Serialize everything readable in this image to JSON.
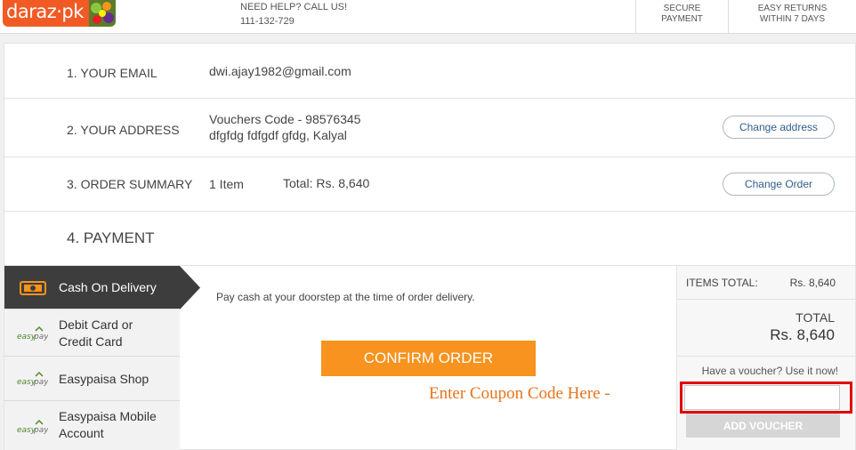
{
  "header": {
    "logo_text": "daraz·pk",
    "help_title": "NEED HELP? CALL US!",
    "help_phone": "111-132-729",
    "secure_line1": "SECURE",
    "secure_line2": "PAYMENT",
    "returns_line1": "EASY RETURNS",
    "returns_line2": "WITHIN 7 DAYS"
  },
  "steps": {
    "email": {
      "label": "1. YOUR EMAIL",
      "value": "dwi.ajay1982@gmail.com"
    },
    "address": {
      "label": "2. YOUR ADDRESS",
      "line1": "Vouchers Code - 98576345",
      "line2": "dfgfdg fdfgdf gfdg, Kalyal",
      "button": "Change address"
    },
    "order": {
      "label": "3. ORDER SUMMARY",
      "items": "1 Item",
      "total": "Total: Rs.  8,640",
      "button": "Change Order"
    },
    "payment": {
      "label": "4. PAYMENT"
    }
  },
  "payment_methods": [
    {
      "line1": "Cash On Delivery",
      "line2": "",
      "icon": "cash-icon"
    },
    {
      "line1": "Debit Card or",
      "line2": "Credit Card",
      "icon": "easypay-logo"
    },
    {
      "line1": "Easypaisa Shop",
      "line2": "",
      "icon": "easypay-logo"
    },
    {
      "line1": "Easypaisa Mobile",
      "line2": "Account",
      "icon": "easypay-logo"
    }
  ],
  "payment_panel": {
    "note": "Pay cash at your doorstep at the time of order delivery.",
    "confirm_button": "CONFIRM ORDER",
    "coupon_annotation": "Enter Coupon Code Here -"
  },
  "summary": {
    "items_label": "ITEMS TOTAL:",
    "items_value": "Rs.  8,640",
    "total_label": "TOTAL",
    "total_value": "Rs.  8,640",
    "voucher_hint": "Have a voucher? Use it now!",
    "voucher_placeholder": "",
    "voucher_button": "ADD VOUCHER"
  },
  "colors": {
    "brand_orange": "#f15a24",
    "confirm_orange": "#f7931e",
    "highlight_red": "#e00000",
    "selected_dark": "#3d3d3d"
  }
}
